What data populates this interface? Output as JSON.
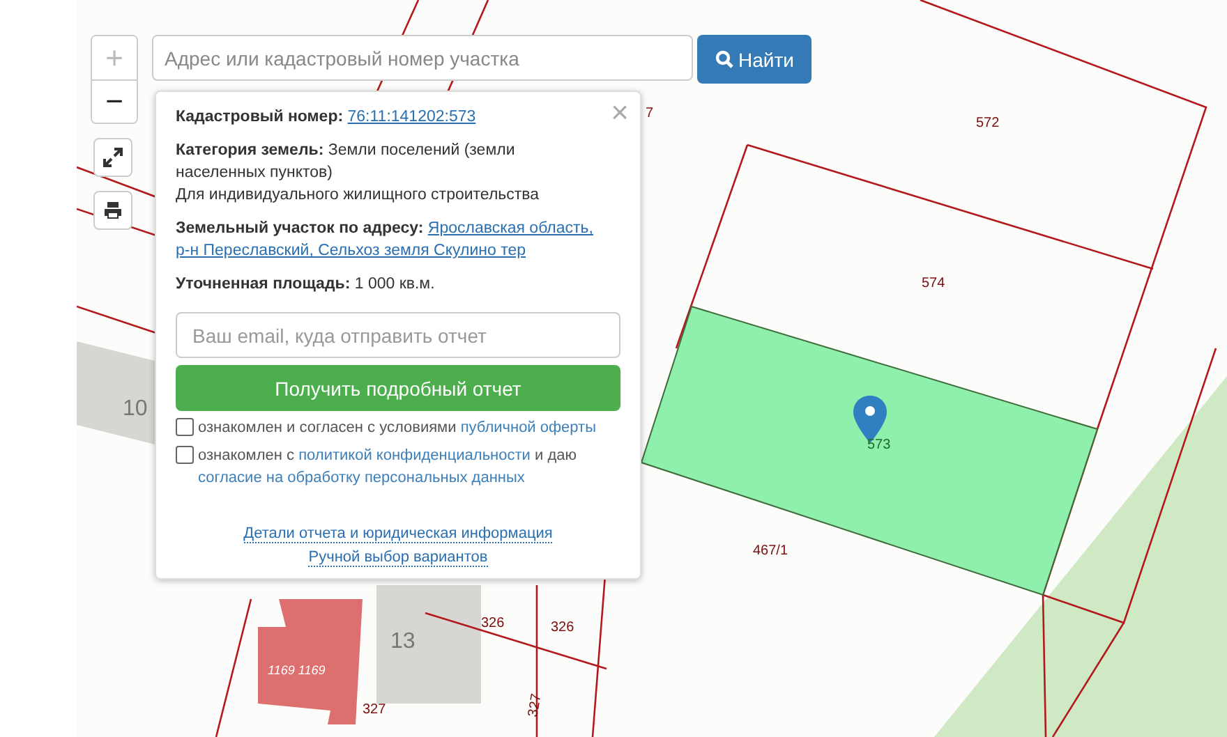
{
  "search": {
    "placeholder": "Адрес или кадастровый номер участка",
    "button": "Найти"
  },
  "map_controls": {
    "zoom_in": "+",
    "zoom_out": "−"
  },
  "popup": {
    "close": "×",
    "fields": [
      {
        "label": "Кадастровый номер:",
        "value": "76:11:141202:573",
        "kind": "link"
      },
      {
        "label": "Категория земель:",
        "value": "Земли поселений (земли населенных пунктов)",
        "note": "Для индивидуального жилищного строительства",
        "kind": "text"
      },
      {
        "label": "Земельный участок по адресу:",
        "value": "Ярославская область,",
        "value_2": "р-н Переславский, Сельхоз земля Скулино тер",
        "kind": "link"
      },
      {
        "label": "Уточненная площадь:",
        "value": "1 000 кв.м.",
        "kind": "text"
      }
    ],
    "email_placeholder": "Ваш email, куда отправить отчет",
    "submit": "Получить подробный отчет",
    "consents": [
      {
        "checked": false,
        "text": "ознакомлен и согласен с условиями ",
        "link": "публичной оферты"
      },
      {
        "checked": false,
        "text": "ознакомлен с ",
        "link": "политикой конфиденциальности",
        "text_after": " и даю ",
        "link_2": "согласие на обработку персональных данных"
      }
    ],
    "footer_links": [
      "Детали отчета и юридическая информация",
      "Ручной выбор вариантов"
    ]
  },
  "map_labels": [
    {
      "text": "572",
      "kind": "parcel"
    },
    {
      "text": "574",
      "kind": "parcel"
    },
    {
      "text": "573",
      "kind": "selected"
    },
    {
      "text": "467/1",
      "kind": "parcel"
    },
    {
      "text": "7",
      "kind": "parcel"
    },
    {
      "text": "10",
      "kind": "house"
    },
    {
      "text": "13",
      "kind": "house"
    },
    {
      "text": "1169 1169",
      "kind": "building"
    },
    {
      "text": "326",
      "kind": "parcel"
    },
    {
      "text": "326",
      "kind": "parcel"
    },
    {
      "text": "327",
      "kind": "parcel"
    },
    {
      "text": "327",
      "kind": "rotated"
    }
  ]
}
